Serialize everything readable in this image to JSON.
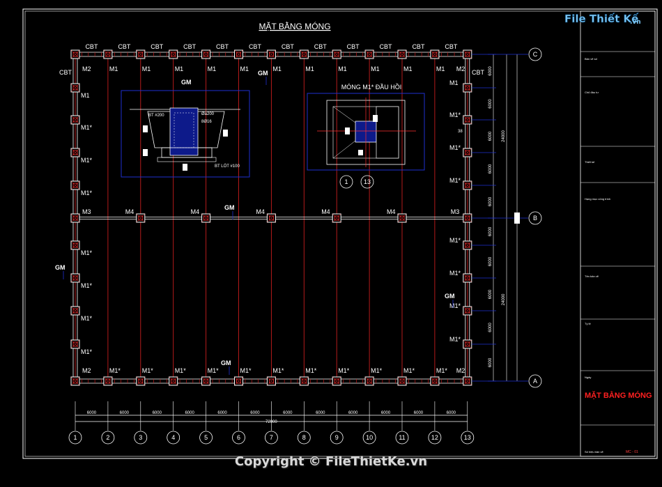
{
  "drawing": {
    "title": "MẶT BẰNG MÓNG",
    "foundation_top": [
      "CBT",
      "CBT",
      "CBT",
      "CBT",
      "CBT",
      "CBT",
      "CBT",
      "CBT",
      "CBT",
      "CBT",
      "CBT",
      "CBT"
    ],
    "cbt_left": "CBT",
    "cbt_right": "CBT",
    "row_top_labels": [
      "M2",
      "M1",
      "M1",
      "M1",
      "M1",
      "M1",
      "M1",
      "M1",
      "M1",
      "M1",
      "M1",
      "M1",
      "M2"
    ],
    "row_mid_labels": [
      "M3",
      "M4",
      "M4",
      "M4",
      "M4",
      "M4",
      "M3"
    ],
    "row_bot_labels": [
      "M2",
      "M1*",
      "M1*",
      "M1*",
      "M1*",
      "M1*",
      "M1*",
      "M1*",
      "M1*",
      "M1*",
      "M1*",
      "M1*",
      "M2"
    ],
    "left_col_labels": [
      "M1",
      "M1*",
      "M1*",
      "M1*",
      "M1*",
      "M1*",
      "M1*",
      "M1*"
    ],
    "right_col_labels": [
      "M1",
      "M1*",
      "M1*",
      "M1*",
      "M1*",
      "M1*",
      "M1*",
      "M1*"
    ],
    "gm_label": "GM",
    "detail1": {
      "gm": "GM",
      "bt200": "BT #200",
      "rebar1": "Øa200",
      "rebar2": "8Ø16",
      "btlot": "BT LÓT #100"
    },
    "detail2": {
      "title": "MÓNG M1* ĐẦU HỒI",
      "dim": "38"
    },
    "detail2_axes": [
      "1",
      "13"
    ],
    "spans": [
      "6000",
      "6000",
      "6000",
      "6000",
      "6000",
      "6000",
      "6000",
      "6000",
      "6000",
      "6000",
      "6000",
      "6000"
    ],
    "total_span": "72000",
    "axes_x": [
      "1",
      "2",
      "3",
      "4",
      "5",
      "6",
      "7",
      "8",
      "9",
      "10",
      "11",
      "12",
      "13"
    ],
    "axes_y": [
      "C",
      "B",
      "A"
    ],
    "vert_dims_inner": [
      "6000",
      "6000",
      "6000",
      "6000",
      "6000",
      "6000",
      "6000",
      "6000",
      "6000",
      "6000"
    ],
    "vert_dims_outer": [
      "24000",
      "24000"
    ]
  },
  "titleblock": {
    "rows": [
      "Bản vẽ số",
      "Chủ đầu tư",
      "Thiết kế",
      "Hạng mục công trình",
      "Tên bản vẽ",
      "Tỷ lệ",
      "Ngày"
    ],
    "sheet_title": "MẶT BẰNG MÓNG",
    "sheet_no": "MC - 01",
    "sheet_label": "Số hiệu bản vẽ"
  },
  "logo": {
    "name": "File Thiết Kế",
    "domain": ".vn"
  },
  "copyright": "Copyright © FileThietKe.vn",
  "colors": {
    "red": "#ff2020",
    "blue": "#1e2fd0",
    "white": "#ffffff",
    "grid_red": "#c81e1e"
  }
}
